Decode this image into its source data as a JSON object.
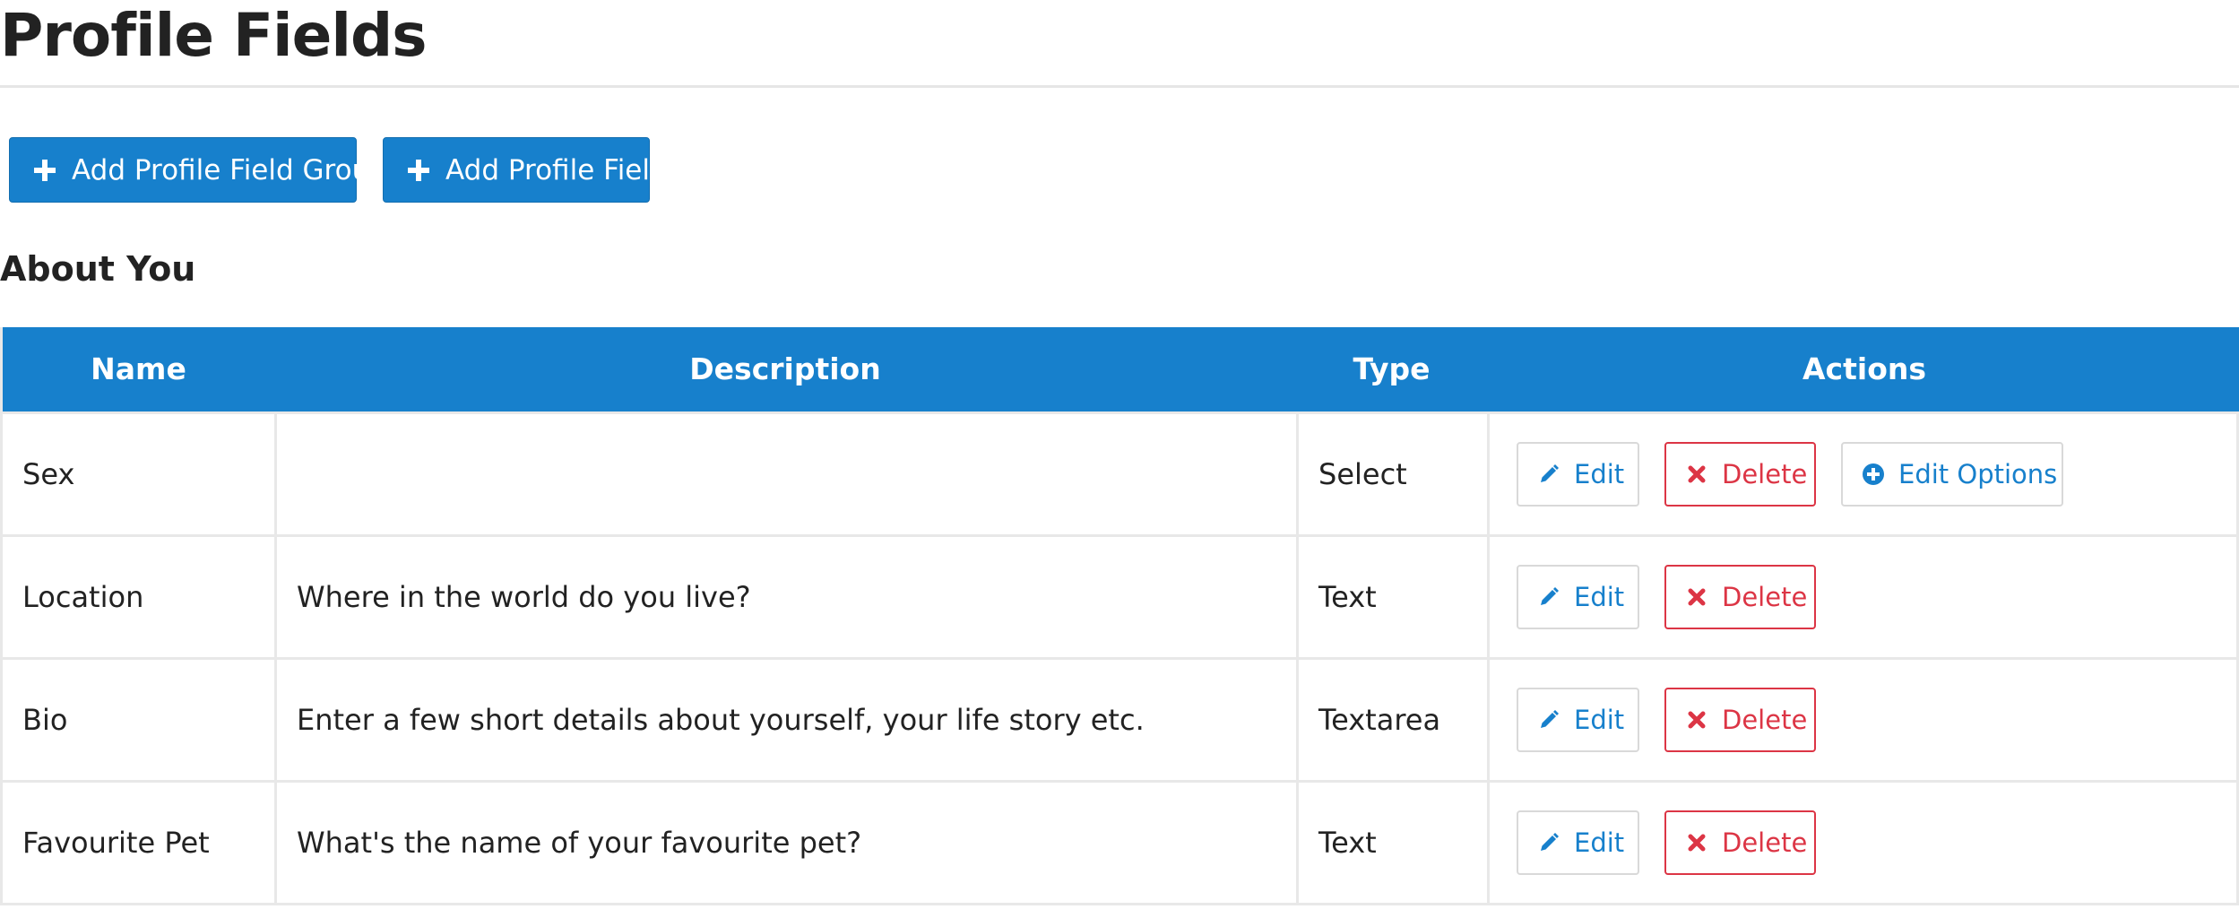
{
  "page": {
    "title": "Profile Fields"
  },
  "toolbar": {
    "add_group_label": "Add Profile Field Group",
    "add_field_label": "Add Profile Field"
  },
  "group": {
    "title": "About You"
  },
  "table": {
    "headers": {
      "name": "Name",
      "description": "Description",
      "type": "Type",
      "actions": "Actions"
    },
    "rows": [
      {
        "name": "Sex",
        "description": "",
        "type": "Select",
        "edit": "Edit",
        "delete": "Delete",
        "edit_options": "Edit Options"
      },
      {
        "name": "Location",
        "description": "Where in the world do you live?",
        "type": "Text",
        "edit": "Edit",
        "delete": "Delete"
      },
      {
        "name": "Bio",
        "description": "Enter a few short details about yourself, your life story etc.",
        "type": "Textarea",
        "edit": "Edit",
        "delete": "Delete"
      },
      {
        "name": "Favourite Pet",
        "description": "What's the name of your favourite pet?",
        "type": "Text",
        "edit": "Edit",
        "delete": "Delete"
      }
    ]
  },
  "icons": {
    "add": "plus-icon",
    "edit": "pencil-icon",
    "delete": "times-icon",
    "edit_options": "plus-circle-icon"
  },
  "colors": {
    "primary": "#1780cc",
    "danger": "#dc3545"
  }
}
